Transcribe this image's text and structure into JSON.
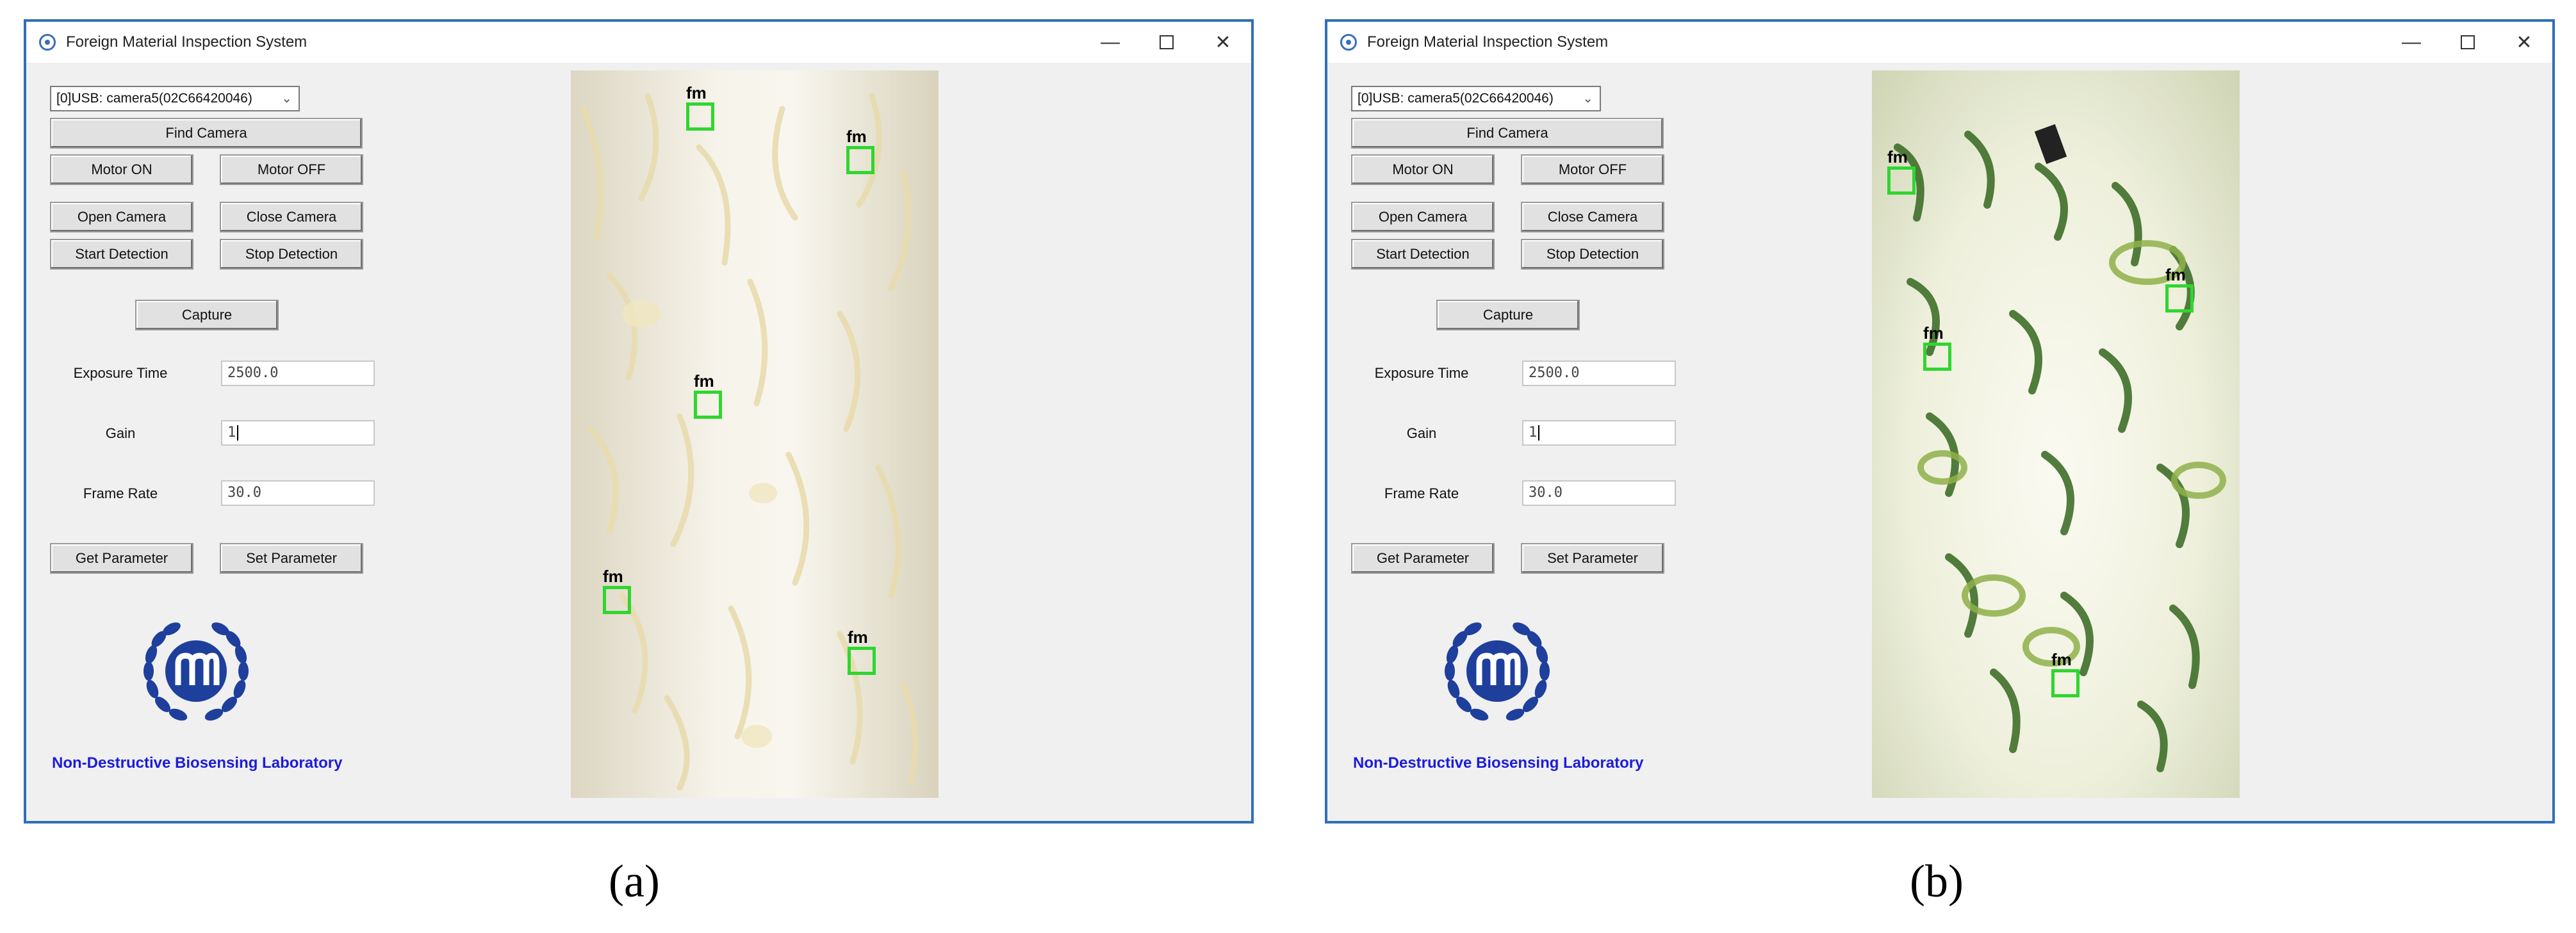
{
  "panels": [
    {
      "caption": "(a)",
      "window": {
        "title": "Foreign Material Inspection System",
        "controls": {
          "minimize": "—",
          "close": "✕"
        }
      },
      "camera_select": {
        "value": "[0]USB: camera5(02C66420046)"
      },
      "buttons": {
        "find_camera": "Find Camera",
        "motor_on": "Motor ON",
        "motor_off": "Motor OFF",
        "open_camera": "Open Camera",
        "close_camera": "Close Camera",
        "start_detection": "Start Detection",
        "stop_detection": "Stop Detection",
        "capture": "Capture",
        "get_parameter": "Get Parameter",
        "set_parameter": "Set Parameter"
      },
      "parameters": {
        "exposure_label": "Exposure Time",
        "exposure_value": "2500.0",
        "gain_label": "Gain",
        "gain_value": "1",
        "frame_rate_label": "Frame Rate",
        "frame_rate_value": "30.0"
      },
      "lab_name": "Non-Destructive Biosensing Laboratory",
      "detections": [
        {
          "label": "fm"
        },
        {
          "label": "fm"
        },
        {
          "label": "fm"
        },
        {
          "label": "fm"
        },
        {
          "label": "fm"
        }
      ],
      "colors": {
        "window_border": "#2f6fb8",
        "detection_box": "#2fd62f",
        "lab_text": "#1c1cdb",
        "logo": "#1e3f9c"
      },
      "icons": [
        "app-icon",
        "chevron-down-icon",
        "minimize-icon",
        "maximize-icon",
        "close-icon",
        "laurel-logo-icon"
      ]
    },
    {
      "caption": "(b)",
      "window": {
        "title": "Foreign Material Inspection System",
        "controls": {
          "minimize": "—",
          "close": "✕"
        }
      },
      "camera_select": {
        "value": "[0]USB: camera5(02C66420046)"
      },
      "buttons": {
        "find_camera": "Find Camera",
        "motor_on": "Motor ON",
        "motor_off": "Motor OFF",
        "open_camera": "Open Camera",
        "close_camera": "Close Camera",
        "start_detection": "Start Detection",
        "stop_detection": "Stop Detection",
        "capture": "Capture",
        "get_parameter": "Get Parameter",
        "set_parameter": "Set Parameter"
      },
      "parameters": {
        "exposure_label": "Exposure Time",
        "exposure_value": "2500.0",
        "gain_label": "Gain",
        "gain_value": "1",
        "frame_rate_label": "Frame Rate",
        "frame_rate_value": "30.0"
      },
      "lab_name": "Non-Destructive Biosensing Laboratory",
      "detections": [
        {
          "label": "fm"
        },
        {
          "label": "fm"
        },
        {
          "label": "fm"
        },
        {
          "label": "fm"
        }
      ],
      "colors": {
        "window_border": "#2f6fb8",
        "detection_box": "#2fd62f",
        "lab_text": "#1c1cdb",
        "logo": "#1e3f9c"
      },
      "icons": [
        "app-icon",
        "chevron-down-icon",
        "minimize-icon",
        "maximize-icon",
        "close-icon",
        "laurel-logo-icon"
      ]
    }
  ]
}
